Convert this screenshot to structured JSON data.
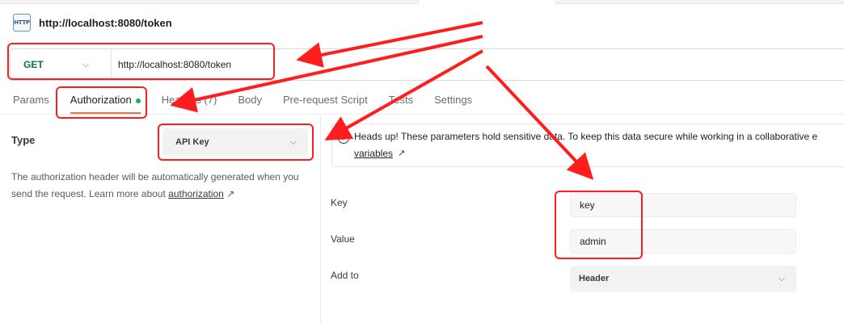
{
  "request": {
    "title": "http://localhost:8080/token",
    "icon": "http-file-icon",
    "icon_text": "HTTP",
    "method": "GET",
    "method_color": "#0b7a34",
    "url": "http://localhost:8080/token"
  },
  "tabs": [
    {
      "label": "Params"
    },
    {
      "label": "Authorization",
      "active": true,
      "status_dot_color": "#1fa85c"
    },
    {
      "label": "Headers (7)"
    },
    {
      "label": "Body"
    },
    {
      "label": "Pre-request Script"
    },
    {
      "label": "Tests"
    },
    {
      "label": "Settings"
    }
  ],
  "auth": {
    "type_label": "Type",
    "type_value": "API Key",
    "description_before": "The authorization header will be automatically generated when you send the request. Learn more about ",
    "description_link": "authorization",
    "description_link_suffix": "↗"
  },
  "notice": {
    "icon": "info-icon",
    "text": "Heads up! These parameters hold sensitive data. To keep this data secure while working in a collaborative e",
    "link": "variables",
    "link_suffix": "↗"
  },
  "fields": {
    "key_label": "Key",
    "key_value": "key",
    "value_label": "Value",
    "value_value": "admin",
    "add_to_label": "Add to",
    "add_to_value": "Header"
  },
  "annotation_color": "#ff1e1e"
}
